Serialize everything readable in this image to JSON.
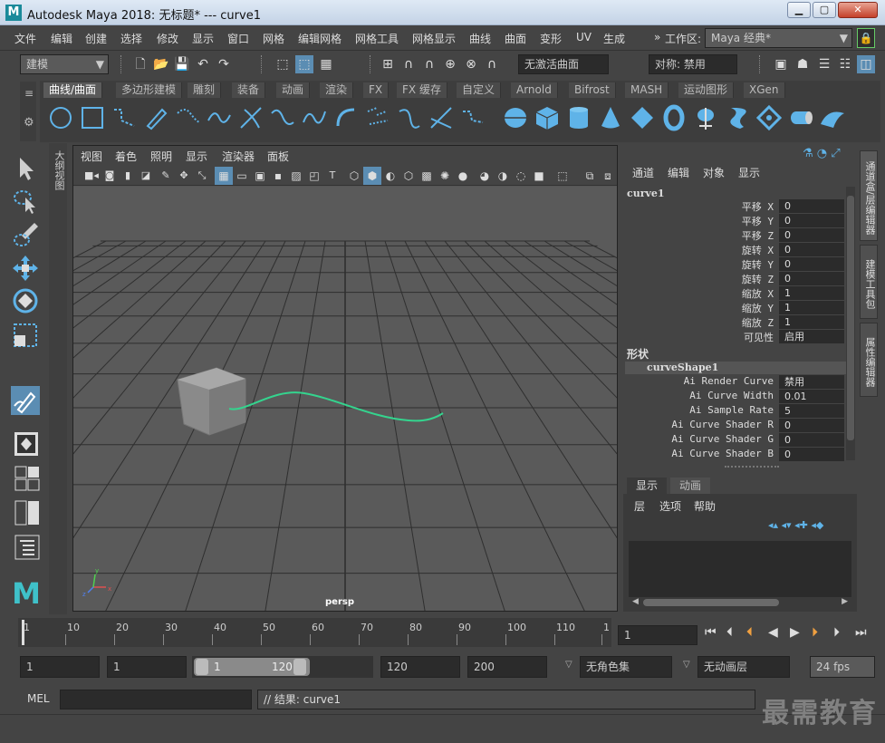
{
  "window": {
    "title": "Autodesk Maya 2018: 无标题*   ---   curve1",
    "logo_letter": "M",
    "minimize": "▁",
    "maximize": "▢",
    "close": "✕"
  },
  "menubar": {
    "items": [
      "文件",
      "编辑",
      "创建",
      "选择",
      "修改",
      "显示",
      "窗口",
      "网格",
      "编辑网格",
      "网格工具",
      "网格显示",
      "曲线",
      "曲面",
      "变形",
      "UV",
      "生成"
    ],
    "workspace_label": "工作区:",
    "workspace_value": "Maya 经典*"
  },
  "statusline": {
    "mode": "建模",
    "live_surface": "无激活曲面",
    "symmetry": "对称: 禁用"
  },
  "shelf": {
    "tabs": [
      "曲线/曲面",
      "多边形建模",
      "雕刻",
      "装备",
      "动画",
      "渲染",
      "FX",
      "FX 缓存",
      "自定义",
      "Arnold",
      "Bifrost",
      "MASH",
      "运动图形",
      "XGen"
    ],
    "active_tab": "曲线/曲面"
  },
  "outliner_tab": "大纲视图",
  "viewport": {
    "menus": [
      "视图",
      "着色",
      "照明",
      "显示",
      "渲染器",
      "面板"
    ],
    "camera_label": "persp",
    "grid_color": "#2f2f2f",
    "bg_color": "#5a5a5a",
    "curve_color": "#34d48e"
  },
  "channelbox": {
    "menus": [
      "通道",
      "编辑",
      "对象",
      "显示"
    ],
    "object_name": "curve1",
    "channels": [
      {
        "label": "平移 X",
        "value": "0"
      },
      {
        "label": "平移 Y",
        "value": "0"
      },
      {
        "label": "平移 Z",
        "value": "0"
      },
      {
        "label": "旋转 X",
        "value": "0"
      },
      {
        "label": "旋转 Y",
        "value": "0"
      },
      {
        "label": "旋转 Z",
        "value": "0"
      },
      {
        "label": "缩放 X",
        "value": "1"
      },
      {
        "label": "缩放 Y",
        "value": "1"
      },
      {
        "label": "缩放 Z",
        "value": "1"
      },
      {
        "label": "可见性",
        "value": "启用"
      }
    ],
    "shapes_header": "形状",
    "shape_name": "curveShape1",
    "shape_attrs": [
      {
        "label": "Ai Render Curve",
        "value": "禁用"
      },
      {
        "label": "Ai Curve Width",
        "value": "0.01"
      },
      {
        "label": "Ai Sample Rate",
        "value": "5"
      },
      {
        "label": "Ai Curve Shader R",
        "value": "0"
      },
      {
        "label": "Ai Curve Shader G",
        "value": "0"
      },
      {
        "label": "Ai Curve Shader B",
        "value": "0"
      }
    ]
  },
  "layers": {
    "tabs": [
      "显示",
      "动画"
    ],
    "active_tab": "显示",
    "menus": [
      "层",
      "选项",
      "帮助"
    ]
  },
  "right_tabs": [
    "通道盒/层编辑器",
    "建模工具包",
    "属性编辑器"
  ],
  "timeslider": {
    "ticks": [
      "1",
      "10",
      "20",
      "30",
      "40",
      "50",
      "60",
      "70",
      "80",
      "90",
      "100",
      "110",
      "1"
    ],
    "current_frame": "1"
  },
  "rangeslider": {
    "start": "1",
    "playback_start": "1",
    "range_start": "1",
    "range_end": "120",
    "playback_end": "120",
    "end": "200",
    "character_set": "无角色集",
    "anim_layer": "无动画层",
    "fps": "24 fps"
  },
  "cmdline": {
    "label": "MEL",
    "result": "// 结果: curve1"
  },
  "watermark": "最需教育"
}
